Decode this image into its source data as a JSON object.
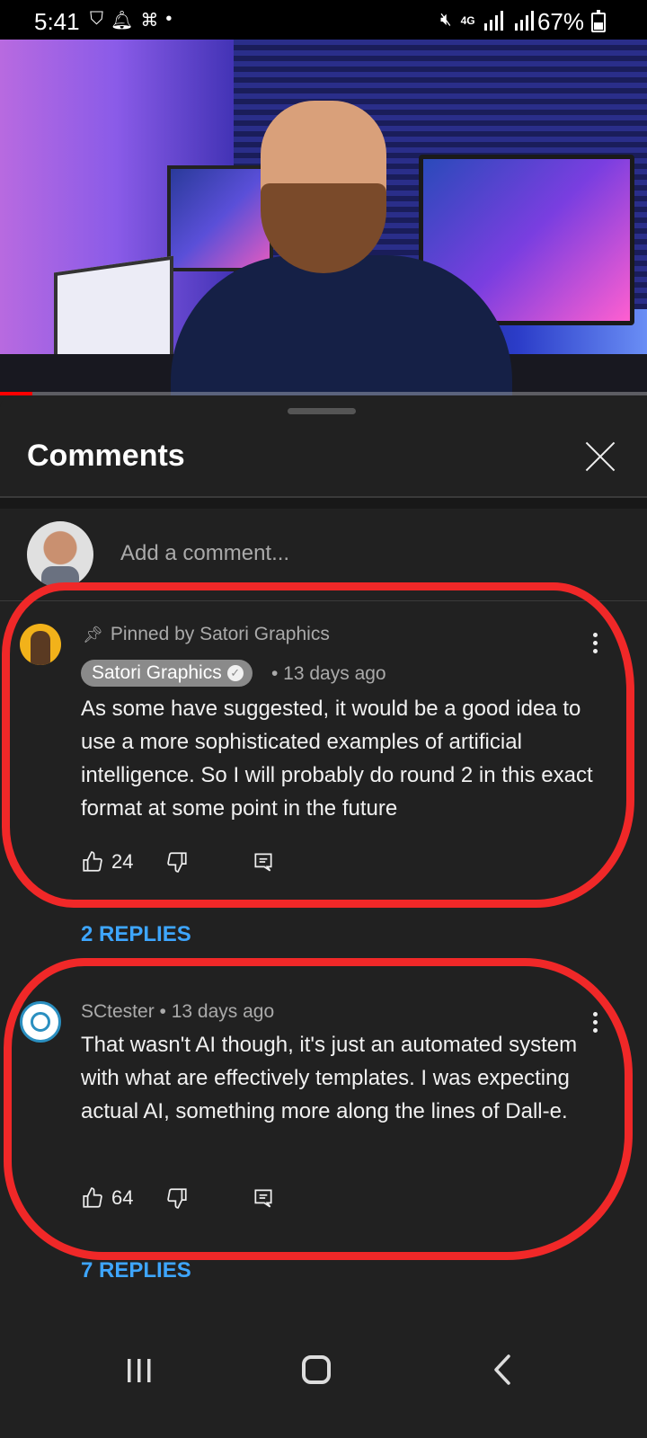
{
  "status_bar": {
    "time": "5:41",
    "left_icons": [
      "vpn-icon",
      "alarm-icon",
      "app-icon",
      "dot-icon"
    ],
    "network": "4G",
    "battery_pct": "67%"
  },
  "video": {
    "progress_fraction": 0.05
  },
  "sheet": {
    "title": "Comments",
    "close_icon": "close-icon",
    "add_comment_placeholder": "Add a comment..."
  },
  "comments": [
    {
      "pinned_label": "Pinned by Satori Graphics",
      "author": "Satori Graphics",
      "verified": true,
      "time": "• 13 days ago",
      "text": "As some have suggested, it would be a good idea to use a more sophisticated examples of artificial intelligence. So I will probably do round 2 in this exact format at some point in the future",
      "likes": "24",
      "replies": "2 REPLIES"
    },
    {
      "author_meta": "SCtester • 13 days ago",
      "text": "That wasn't AI though, it's just an automated system with what are effectively templates. I was expecting actual AI, something more along the lines of Dall-e.",
      "likes": "64",
      "replies": "7 REPLIES"
    }
  ],
  "colors": {
    "background": "#212121",
    "link": "#3ea6ff",
    "annotation": "#f02828",
    "progress": "#ff0000"
  }
}
